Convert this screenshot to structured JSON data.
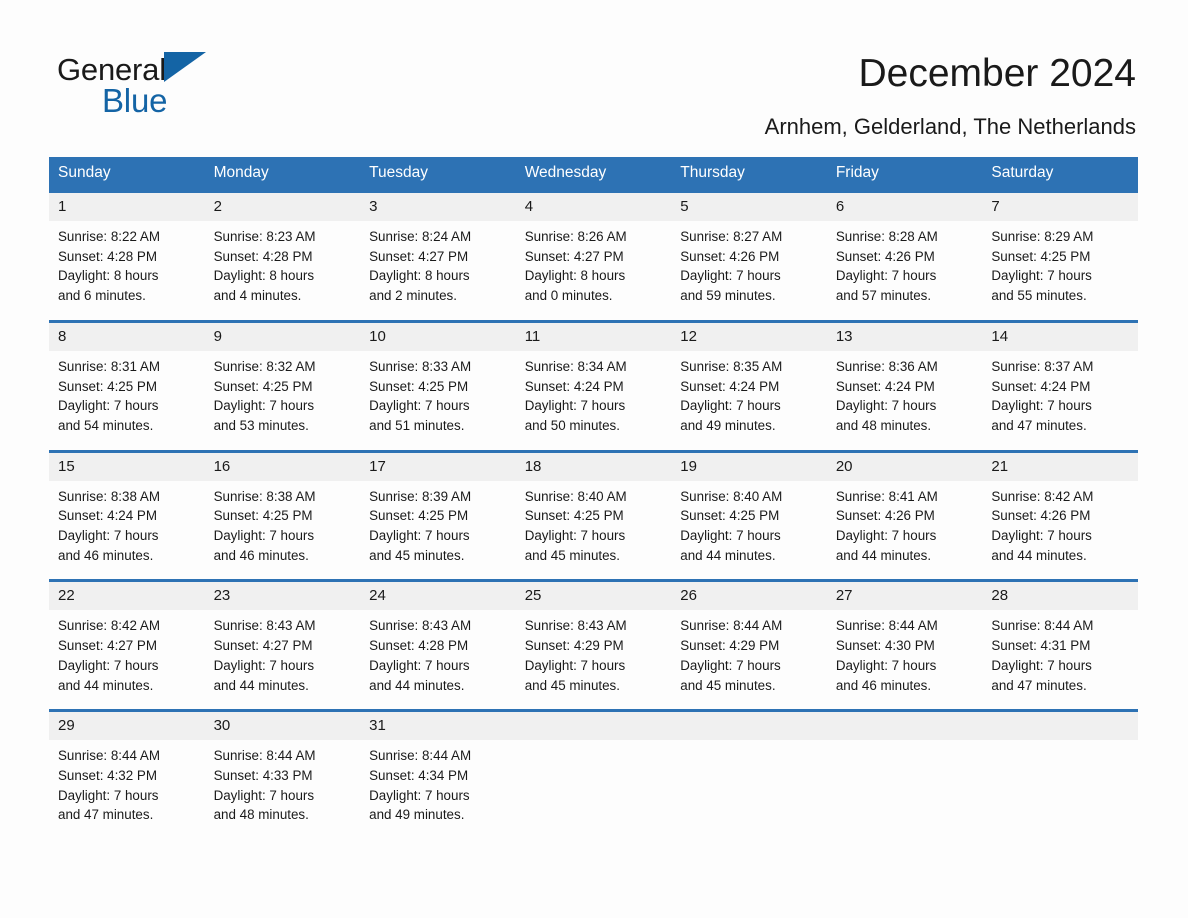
{
  "brand": {
    "name_part1": "General",
    "name_part2": "Blue",
    "triangle_color": "#1464a5"
  },
  "header": {
    "title": "December 2024",
    "subtitle": "Arnhem, Gelderland, The Netherlands"
  },
  "theme": {
    "header_blue": "#2d72b4",
    "daynum_gray": "#f0f0f0",
    "page_background": "#fdfdfd"
  },
  "calendar": {
    "weekday_headers": [
      "Sunday",
      "Monday",
      "Tuesday",
      "Wednesday",
      "Thursday",
      "Friday",
      "Saturday"
    ],
    "weeks": [
      [
        {
          "day": "1",
          "sunrise": "Sunrise: 8:22 AM",
          "sunset": "Sunset: 4:28 PM",
          "daylight_line1": "Daylight: 8 hours",
          "daylight_line2": "and 6 minutes."
        },
        {
          "day": "2",
          "sunrise": "Sunrise: 8:23 AM",
          "sunset": "Sunset: 4:28 PM",
          "daylight_line1": "Daylight: 8 hours",
          "daylight_line2": "and 4 minutes."
        },
        {
          "day": "3",
          "sunrise": "Sunrise: 8:24 AM",
          "sunset": "Sunset: 4:27 PM",
          "daylight_line1": "Daylight: 8 hours",
          "daylight_line2": "and 2 minutes."
        },
        {
          "day": "4",
          "sunrise": "Sunrise: 8:26 AM",
          "sunset": "Sunset: 4:27 PM",
          "daylight_line1": "Daylight: 8 hours",
          "daylight_line2": "and 0 minutes."
        },
        {
          "day": "5",
          "sunrise": "Sunrise: 8:27 AM",
          "sunset": "Sunset: 4:26 PM",
          "daylight_line1": "Daylight: 7 hours",
          "daylight_line2": "and 59 minutes."
        },
        {
          "day": "6",
          "sunrise": "Sunrise: 8:28 AM",
          "sunset": "Sunset: 4:26 PM",
          "daylight_line1": "Daylight: 7 hours",
          "daylight_line2": "and 57 minutes."
        },
        {
          "day": "7",
          "sunrise": "Sunrise: 8:29 AM",
          "sunset": "Sunset: 4:25 PM",
          "daylight_line1": "Daylight: 7 hours",
          "daylight_line2": "and 55 minutes."
        }
      ],
      [
        {
          "day": "8",
          "sunrise": "Sunrise: 8:31 AM",
          "sunset": "Sunset: 4:25 PM",
          "daylight_line1": "Daylight: 7 hours",
          "daylight_line2": "and 54 minutes."
        },
        {
          "day": "9",
          "sunrise": "Sunrise: 8:32 AM",
          "sunset": "Sunset: 4:25 PM",
          "daylight_line1": "Daylight: 7 hours",
          "daylight_line2": "and 53 minutes."
        },
        {
          "day": "10",
          "sunrise": "Sunrise: 8:33 AM",
          "sunset": "Sunset: 4:25 PM",
          "daylight_line1": "Daylight: 7 hours",
          "daylight_line2": "and 51 minutes."
        },
        {
          "day": "11",
          "sunrise": "Sunrise: 8:34 AM",
          "sunset": "Sunset: 4:24 PM",
          "daylight_line1": "Daylight: 7 hours",
          "daylight_line2": "and 50 minutes."
        },
        {
          "day": "12",
          "sunrise": "Sunrise: 8:35 AM",
          "sunset": "Sunset: 4:24 PM",
          "daylight_line1": "Daylight: 7 hours",
          "daylight_line2": "and 49 minutes."
        },
        {
          "day": "13",
          "sunrise": "Sunrise: 8:36 AM",
          "sunset": "Sunset: 4:24 PM",
          "daylight_line1": "Daylight: 7 hours",
          "daylight_line2": "and 48 minutes."
        },
        {
          "day": "14",
          "sunrise": "Sunrise: 8:37 AM",
          "sunset": "Sunset: 4:24 PM",
          "daylight_line1": "Daylight: 7 hours",
          "daylight_line2": "and 47 minutes."
        }
      ],
      [
        {
          "day": "15",
          "sunrise": "Sunrise: 8:38 AM",
          "sunset": "Sunset: 4:24 PM",
          "daylight_line1": "Daylight: 7 hours",
          "daylight_line2": "and 46 minutes."
        },
        {
          "day": "16",
          "sunrise": "Sunrise: 8:38 AM",
          "sunset": "Sunset: 4:25 PM",
          "daylight_line1": "Daylight: 7 hours",
          "daylight_line2": "and 46 minutes."
        },
        {
          "day": "17",
          "sunrise": "Sunrise: 8:39 AM",
          "sunset": "Sunset: 4:25 PM",
          "daylight_line1": "Daylight: 7 hours",
          "daylight_line2": "and 45 minutes."
        },
        {
          "day": "18",
          "sunrise": "Sunrise: 8:40 AM",
          "sunset": "Sunset: 4:25 PM",
          "daylight_line1": "Daylight: 7 hours",
          "daylight_line2": "and 45 minutes."
        },
        {
          "day": "19",
          "sunrise": "Sunrise: 8:40 AM",
          "sunset": "Sunset: 4:25 PM",
          "daylight_line1": "Daylight: 7 hours",
          "daylight_line2": "and 44 minutes."
        },
        {
          "day": "20",
          "sunrise": "Sunrise: 8:41 AM",
          "sunset": "Sunset: 4:26 PM",
          "daylight_line1": "Daylight: 7 hours",
          "daylight_line2": "and 44 minutes."
        },
        {
          "day": "21",
          "sunrise": "Sunrise: 8:42 AM",
          "sunset": "Sunset: 4:26 PM",
          "daylight_line1": "Daylight: 7 hours",
          "daylight_line2": "and 44 minutes."
        }
      ],
      [
        {
          "day": "22",
          "sunrise": "Sunrise: 8:42 AM",
          "sunset": "Sunset: 4:27 PM",
          "daylight_line1": "Daylight: 7 hours",
          "daylight_line2": "and 44 minutes."
        },
        {
          "day": "23",
          "sunrise": "Sunrise: 8:43 AM",
          "sunset": "Sunset: 4:27 PM",
          "daylight_line1": "Daylight: 7 hours",
          "daylight_line2": "and 44 minutes."
        },
        {
          "day": "24",
          "sunrise": "Sunrise: 8:43 AM",
          "sunset": "Sunset: 4:28 PM",
          "daylight_line1": "Daylight: 7 hours",
          "daylight_line2": "and 44 minutes."
        },
        {
          "day": "25",
          "sunrise": "Sunrise: 8:43 AM",
          "sunset": "Sunset: 4:29 PM",
          "daylight_line1": "Daylight: 7 hours",
          "daylight_line2": "and 45 minutes."
        },
        {
          "day": "26",
          "sunrise": "Sunrise: 8:44 AM",
          "sunset": "Sunset: 4:29 PM",
          "daylight_line1": "Daylight: 7 hours",
          "daylight_line2": "and 45 minutes."
        },
        {
          "day": "27",
          "sunrise": "Sunrise: 8:44 AM",
          "sunset": "Sunset: 4:30 PM",
          "daylight_line1": "Daylight: 7 hours",
          "daylight_line2": "and 46 minutes."
        },
        {
          "day": "28",
          "sunrise": "Sunrise: 8:44 AM",
          "sunset": "Sunset: 4:31 PM",
          "daylight_line1": "Daylight: 7 hours",
          "daylight_line2": "and 47 minutes."
        }
      ],
      [
        {
          "day": "29",
          "sunrise": "Sunrise: 8:44 AM",
          "sunset": "Sunset: 4:32 PM",
          "daylight_line1": "Daylight: 7 hours",
          "daylight_line2": "and 47 minutes."
        },
        {
          "day": "30",
          "sunrise": "Sunrise: 8:44 AM",
          "sunset": "Sunset: 4:33 PM",
          "daylight_line1": "Daylight: 7 hours",
          "daylight_line2": "and 48 minutes."
        },
        {
          "day": "31",
          "sunrise": "Sunrise: 8:44 AM",
          "sunset": "Sunset: 4:34 PM",
          "daylight_line1": "Daylight: 7 hours",
          "daylight_line2": "and 49 minutes."
        },
        {
          "day": "",
          "sunrise": "",
          "sunset": "",
          "daylight_line1": "",
          "daylight_line2": ""
        },
        {
          "day": "",
          "sunrise": "",
          "sunset": "",
          "daylight_line1": "",
          "daylight_line2": ""
        },
        {
          "day": "",
          "sunrise": "",
          "sunset": "",
          "daylight_line1": "",
          "daylight_line2": ""
        },
        {
          "day": "",
          "sunrise": "",
          "sunset": "",
          "daylight_line1": "",
          "daylight_line2": ""
        }
      ]
    ]
  }
}
